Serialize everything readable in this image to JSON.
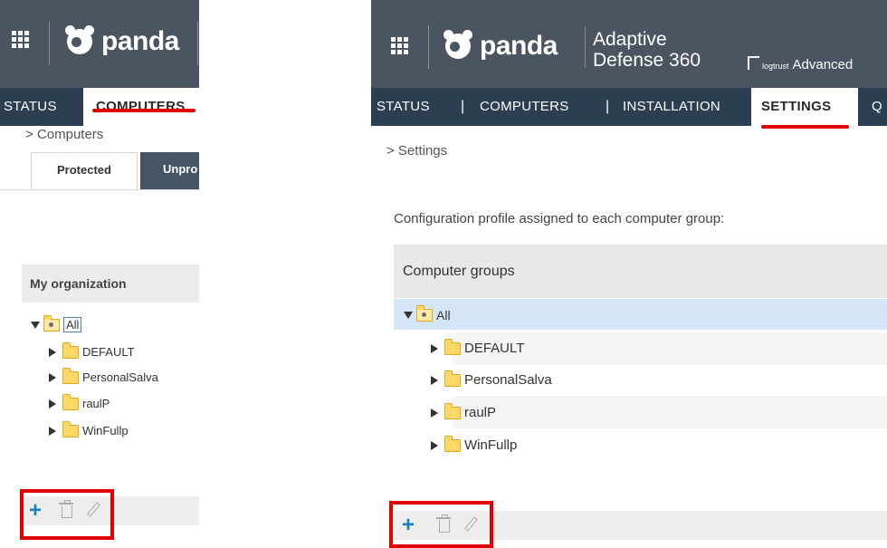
{
  "left": {
    "brand": "panda",
    "nav": {
      "status": "STATUS",
      "computers": "COMPUTERS"
    },
    "breadcrumb": "> Computers",
    "tabs": {
      "protected": "Protected",
      "unprotected": "Unpro"
    },
    "org_header": "My organization",
    "tree": {
      "root": "All",
      "children": [
        "DEFAULT",
        "PersonalSalva",
        "raulP",
        "WinFullp"
      ]
    }
  },
  "right": {
    "brand": "panda",
    "product_line1": "Adaptive",
    "product_line2": "Defense 360",
    "logtrust_small": "logtrust",
    "logtrust_text": "Advanced",
    "nav": {
      "status": "STATUS",
      "sep": "|",
      "computers": "COMPUTERS",
      "installation": "INSTALLATION",
      "settings": "SETTINGS",
      "partial": "Q"
    },
    "breadcrumb": "> Settings",
    "config_text": "Configuration profile assigned to each computer group:",
    "groups_header": "Computer groups",
    "tree": {
      "root": "All",
      "children": [
        "DEFAULT",
        "PersonalSalva",
        "raulP",
        "WinFullp"
      ]
    }
  },
  "colors": {
    "topbar": "#4b5561",
    "navbar": "#2c3f52",
    "highlight": "#e00000",
    "accent": "#1d7fc4",
    "selected_row": "#d6e6fa"
  },
  "icons": [
    "apps-grid-icon",
    "panda-logo-icon",
    "triangle-down-icon",
    "triangle-right-icon",
    "folder-icon",
    "plus-icon",
    "trash-icon",
    "pencil-icon"
  ]
}
